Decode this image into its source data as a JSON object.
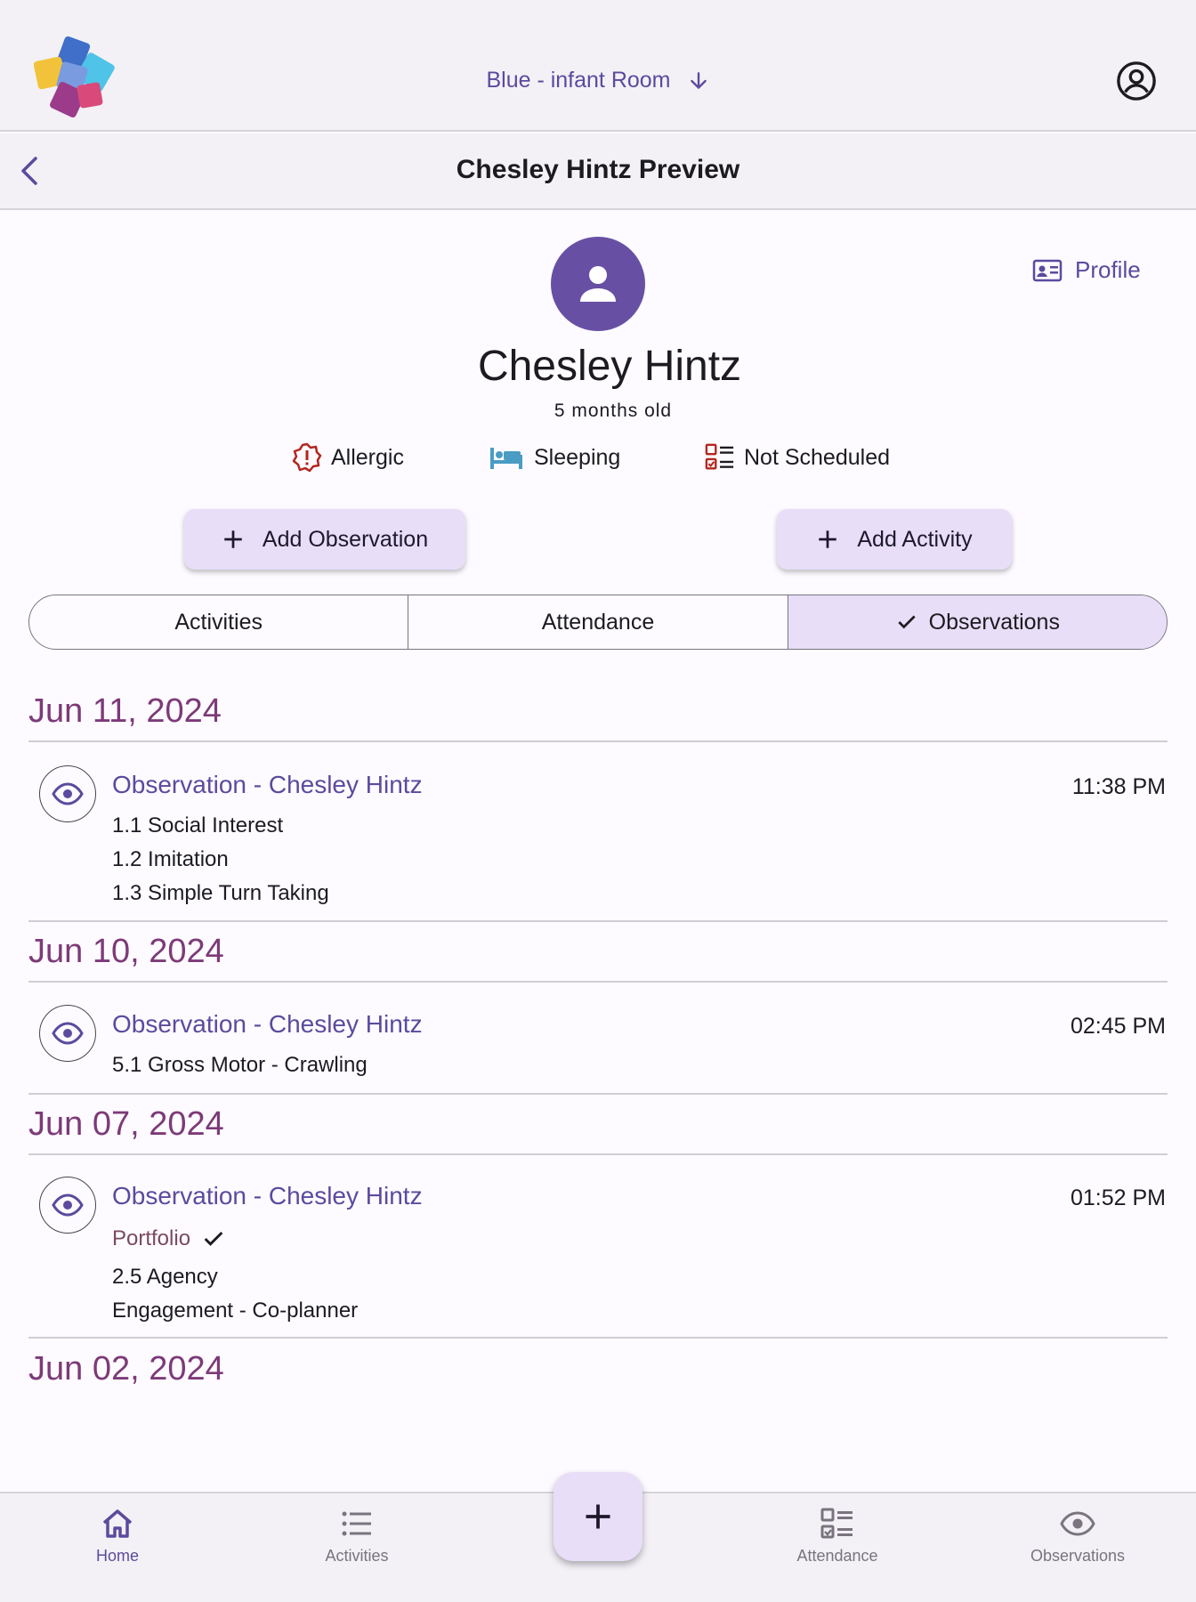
{
  "header": {
    "room_label": "Blue - infant Room",
    "title": "Chesley Hintz Preview"
  },
  "child": {
    "name": "Chesley Hintz",
    "age": "5 months old",
    "profile_label": "Profile"
  },
  "status": {
    "allergic": "Allergic",
    "sleeping": "Sleeping",
    "schedule": "Not Scheduled"
  },
  "actions": {
    "add_observation": "Add Observation",
    "add_activity": "Add Activity"
  },
  "tabs": [
    {
      "label": "Activities",
      "selected": false
    },
    {
      "label": "Attendance",
      "selected": false
    },
    {
      "label": "Observations",
      "selected": true
    }
  ],
  "timeline": [
    {
      "date": "Jun 11, 2024",
      "entry": {
        "title": "Observation - Chesley Hintz",
        "time": "11:38 PM",
        "lines": [
          "1.1 Social Interest",
          "1.2 Imitation",
          "1.3 Simple Turn Taking"
        ]
      }
    },
    {
      "date": "Jun 10, 2024",
      "entry": {
        "title": "Observation - Chesley Hintz",
        "time": "02:45 PM",
        "lines": [
          "5.1 Gross Motor - Crawling"
        ]
      }
    },
    {
      "date": "Jun 07, 2024",
      "entry": {
        "title": "Observation - Chesley Hintz",
        "time": "01:52 PM",
        "portfolio": "Portfolio",
        "lines": [
          "2.5 Agency",
          "Engagement - Co-planner"
        ]
      }
    },
    {
      "date": "Jun 02, 2024"
    }
  ],
  "nav": {
    "home": "Home",
    "activities": "Activities",
    "attendance": "Attendance",
    "observations": "Observations"
  },
  "colors": {
    "accent": "#5c4a9e",
    "date_heading": "#7d3a78",
    "tonal_container": "#e8def8",
    "alert_red": "#b3261e",
    "bed_blue": "#4a9cc4"
  }
}
